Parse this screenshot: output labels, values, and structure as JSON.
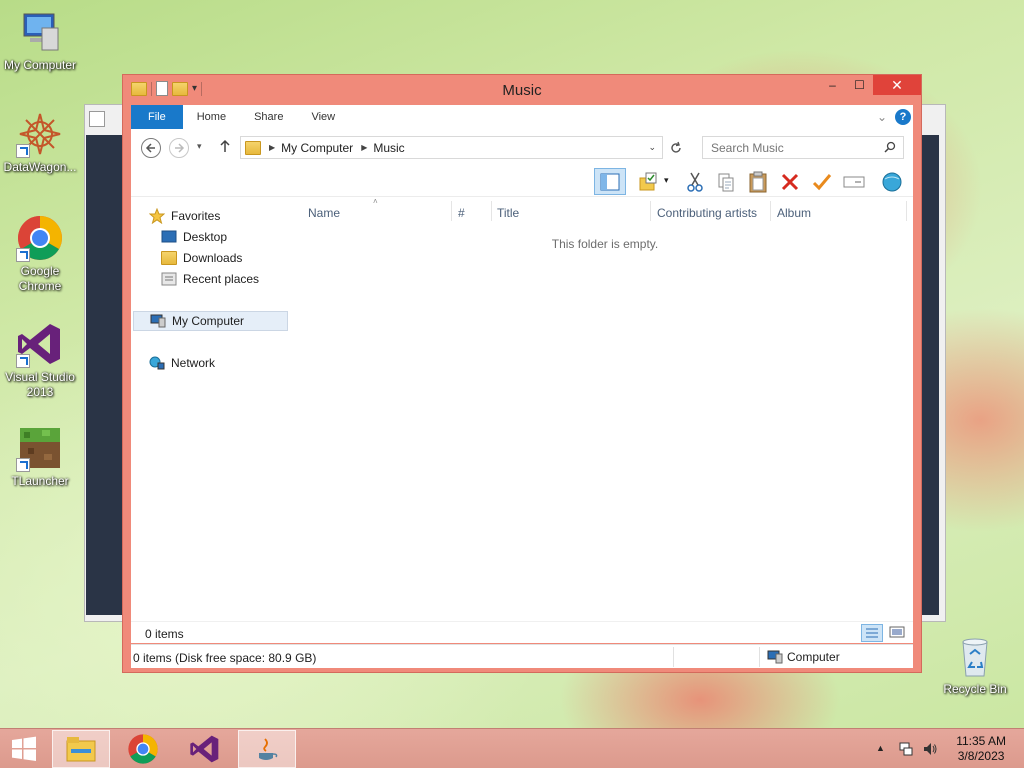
{
  "desktop": {
    "icons": [
      {
        "label": "My Computer"
      },
      {
        "label": "DataWagon..."
      },
      {
        "label": "Google Chrome"
      },
      {
        "label": "Visual Studio 2013"
      },
      {
        "label": "TLauncher"
      },
      {
        "label": "Recycle Bin"
      }
    ]
  },
  "window": {
    "title": "Music",
    "caption_buttons": {
      "minimize": "–",
      "maximize": "☐",
      "close": "✕"
    }
  },
  "ribbon": {
    "tabs": [
      "File",
      "Home",
      "Share",
      "View"
    ],
    "expand_glyph": "⌄",
    "help_glyph": "?"
  },
  "address": {
    "breadcrumb": [
      "My Computer",
      "Music"
    ],
    "search_placeholder": "Search Music"
  },
  "navpane": {
    "favorites": "Favorites",
    "favorite_items": [
      "Desktop",
      "Downloads",
      "Recent places"
    ],
    "computer": "My Computer",
    "network": "Network"
  },
  "fileview": {
    "columns": [
      "Name",
      "#",
      "Title",
      "Contributing artists",
      "Album"
    ],
    "empty_message": "This folder is empty."
  },
  "status": {
    "item_count": "0 items",
    "details": "0 items (Disk free space: 80.9 GB)",
    "location": "Computer"
  },
  "taskbar": {
    "time": "11:35 AM",
    "date": "3/8/2023"
  },
  "colors": {
    "window_frame": "#f08a7a",
    "close_button": "#e0433a",
    "file_tab": "#1979ca",
    "taskbar": "#dc9a8d"
  }
}
